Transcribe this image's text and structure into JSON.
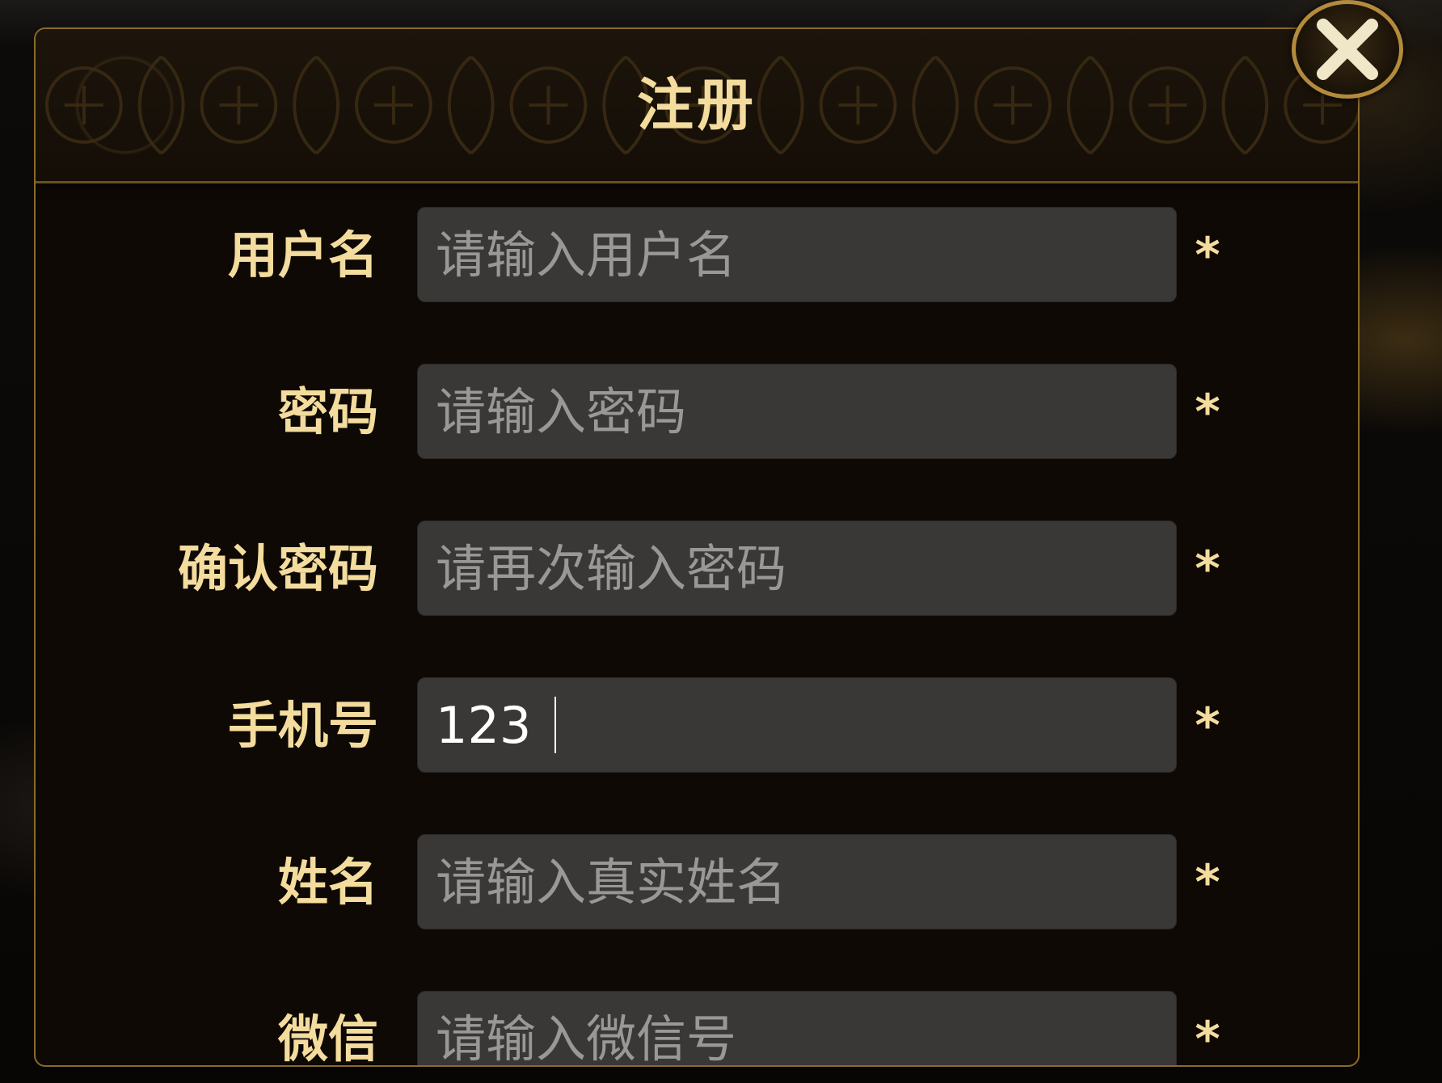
{
  "dialog": {
    "title": "注册",
    "close_icon": "close-icon"
  },
  "form": {
    "required_marker": "*",
    "fields": [
      {
        "label": "用户名",
        "placeholder": "请输入用户名",
        "value": ""
      },
      {
        "label": "密码",
        "placeholder": "请输入密码",
        "value": ""
      },
      {
        "label": "确认密码",
        "placeholder": "请再次输入密码",
        "value": ""
      },
      {
        "label": "手机号",
        "placeholder": "",
        "value": "123"
      },
      {
        "label": "姓名",
        "placeholder": "请输入真实姓名",
        "value": ""
      },
      {
        "label": "微信",
        "placeholder": "请输入微信号",
        "value": ""
      }
    ]
  },
  "colors": {
    "accent_gold": "#f3dc9d",
    "border_gold": "#8a6a2c",
    "input_bg": "#3a3836"
  }
}
